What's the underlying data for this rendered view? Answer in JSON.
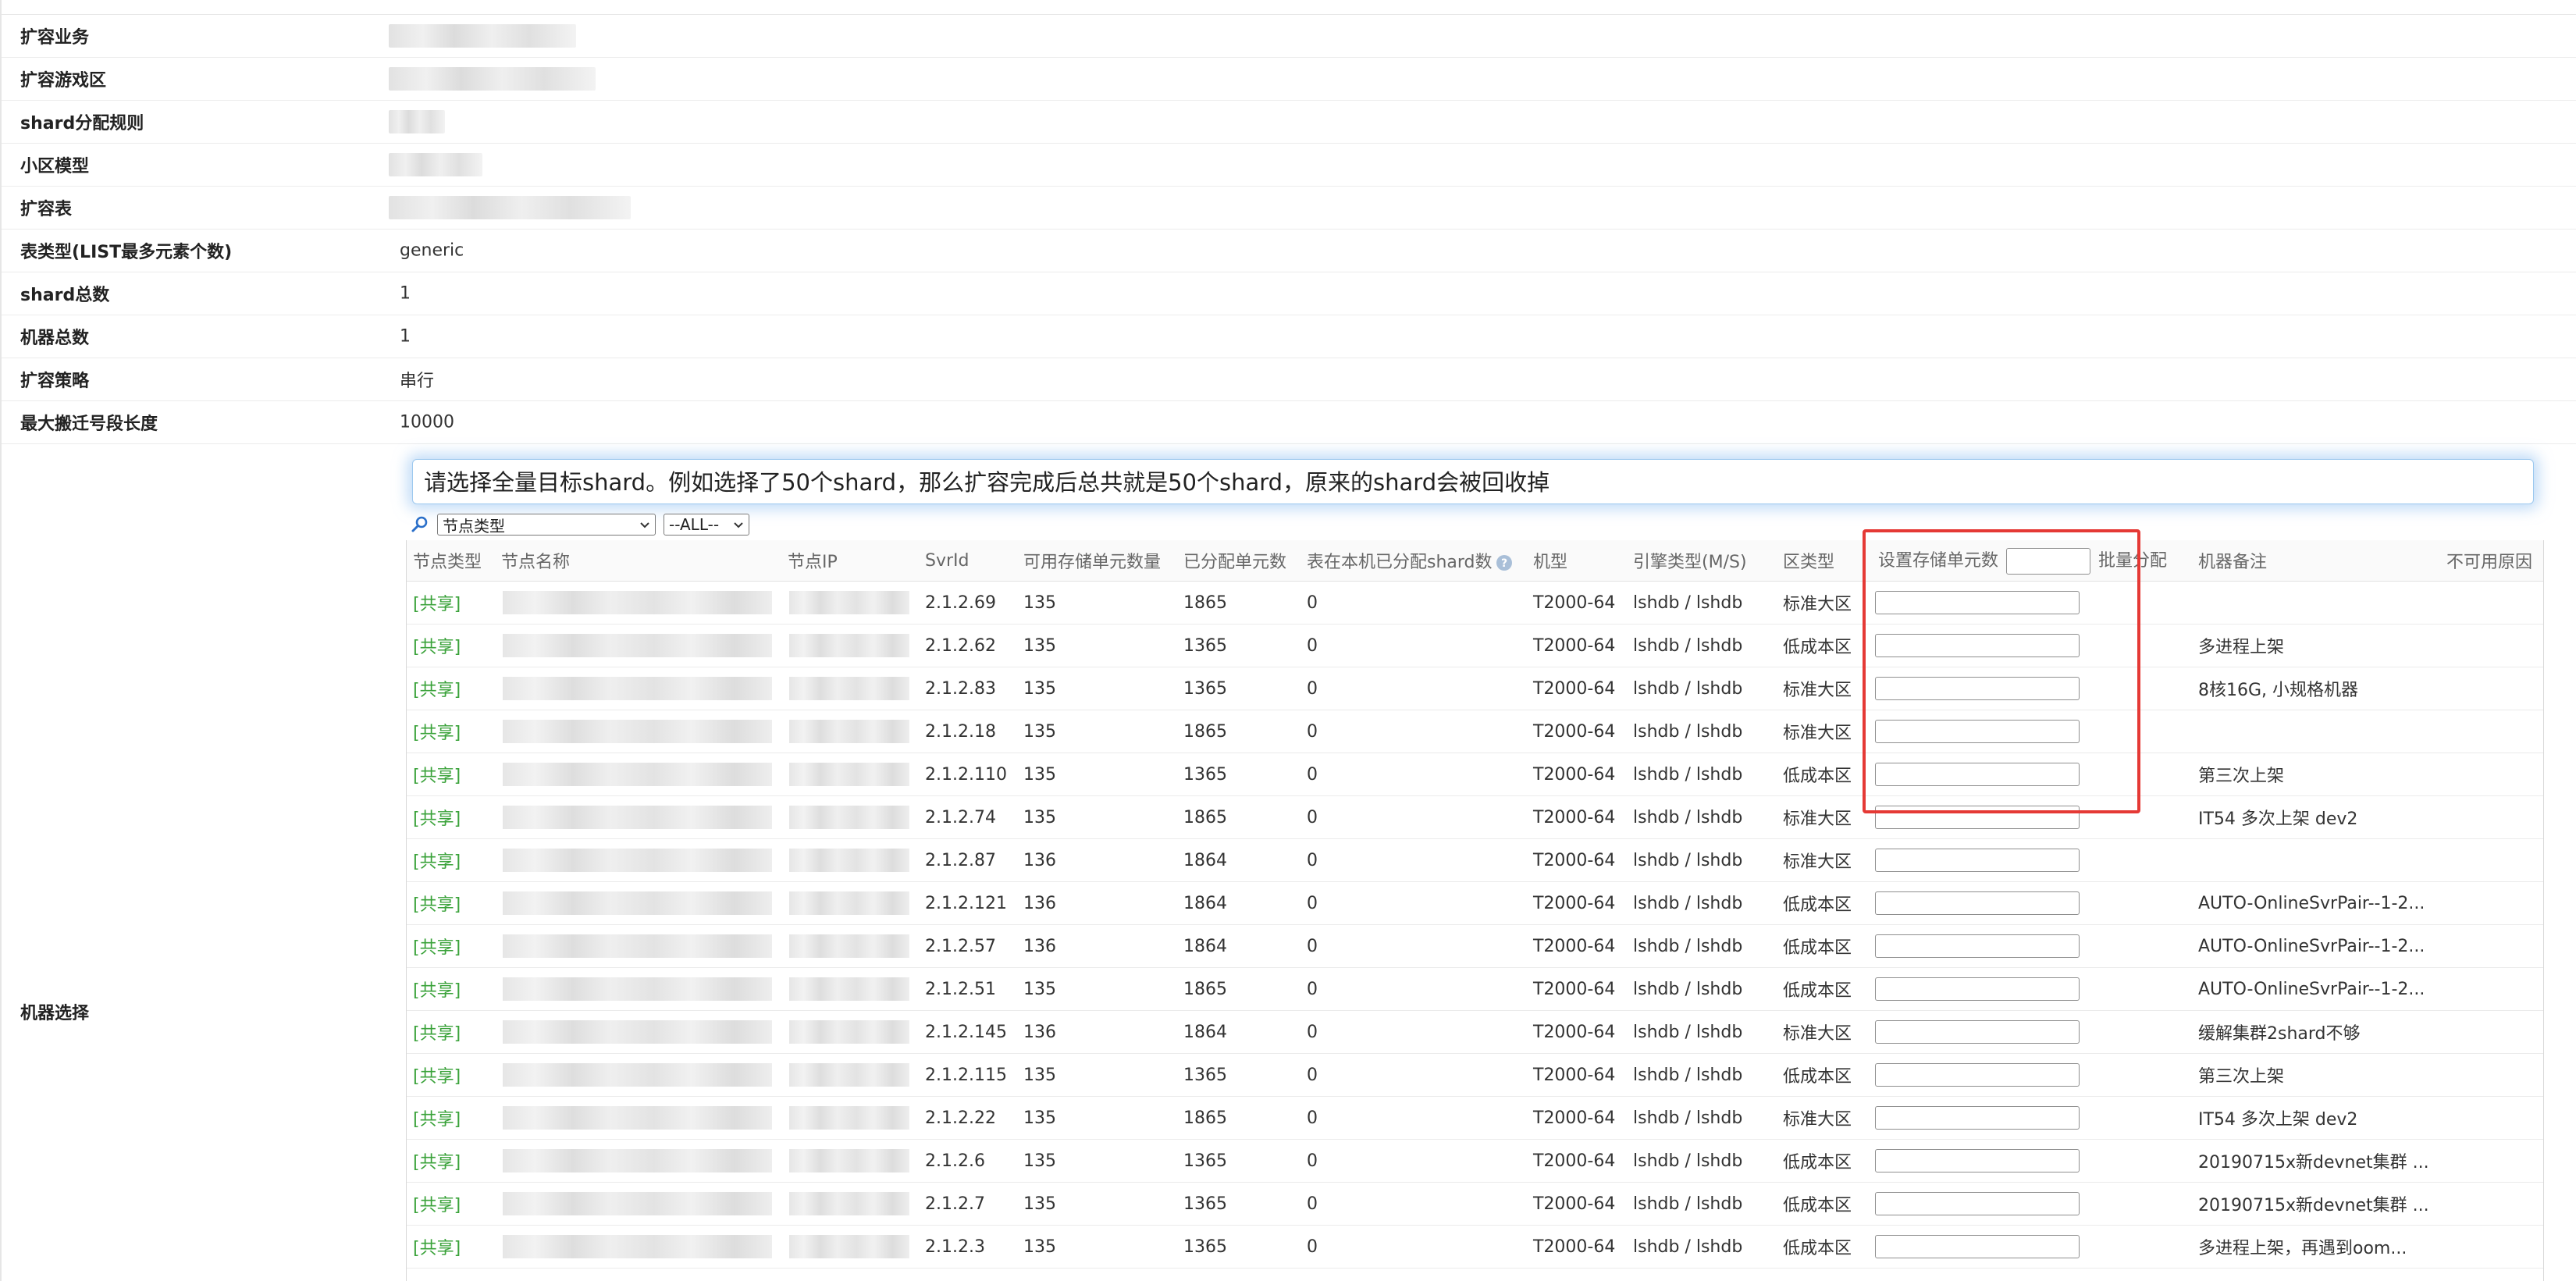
{
  "info": [
    {
      "label": "扩容业务",
      "value": "",
      "redacted": true
    },
    {
      "label": "扩容游戏区",
      "value": "",
      "redacted": true
    },
    {
      "label": "shard分配规则",
      "value": "",
      "redacted": true
    },
    {
      "label": "小区模型",
      "value": "",
      "redacted": true
    },
    {
      "label": "扩容表",
      "value": "",
      "redacted": true
    },
    {
      "label": "表类型(LIST最多元素个数)",
      "value": "generic",
      "redacted": false
    },
    {
      "label": "shard总数",
      "value": "1",
      "redacted": false
    },
    {
      "label": "机器总数",
      "value": "1",
      "redacted": false
    },
    {
      "label": "扩容策略",
      "value": "串行",
      "redacted": false
    },
    {
      "label": "最大搬迁号段长度",
      "value": "10000",
      "redacted": false
    }
  ],
  "machine_section": {
    "label": "机器选择",
    "hint": "请选择全量目标shard。例如选择了50个shard，那么扩容完成后总共就是50个shard，原来的shard会被回收掉",
    "filter_type_value": "节点类型",
    "filter_all_value": "--ALL--",
    "search_icon": "search-icon"
  },
  "table": {
    "headers": {
      "node_type": "节点类型",
      "node_name": "节点名称",
      "node_ip": "节点IP",
      "svrid": "SvrId",
      "avail": "可用存储单元数量",
      "alloc": "已分配单元数",
      "local_shard": "表在本机已分配shard数",
      "model": "机型",
      "engine": "引擎类型(M/S)",
      "zone": "区类型",
      "set_units": "设置存储单元数",
      "batch": "批量分配",
      "remark": "机器备注",
      "unavail": "不可用原因"
    },
    "rows": [
      {
        "type": "[共享]",
        "svrid": "2.1.2.69",
        "avail": "135",
        "alloc": "1865",
        "local": "0",
        "model": "T2000-64",
        "engine": "lshdb / lshdb",
        "zone": "标准大区",
        "remark": ""
      },
      {
        "type": "[共享]",
        "svrid": "2.1.2.62",
        "avail": "135",
        "alloc": "1365",
        "local": "0",
        "model": "T2000-64",
        "engine": "lshdb / lshdb",
        "zone": "低成本区",
        "remark": "多进程上架"
      },
      {
        "type": "[共享]",
        "svrid": "2.1.2.83",
        "avail": "135",
        "alloc": "1365",
        "local": "0",
        "model": "T2000-64",
        "engine": "lshdb / lshdb",
        "zone": "标准大区",
        "remark": "8核16G, 小规格机器"
      },
      {
        "type": "[共享]",
        "svrid": "2.1.2.18",
        "avail": "135",
        "alloc": "1865",
        "local": "0",
        "model": "T2000-64",
        "engine": "lshdb / lshdb",
        "zone": "标准大区",
        "remark": ""
      },
      {
        "type": "[共享]",
        "svrid": "2.1.2.110",
        "avail": "135",
        "alloc": "1365",
        "local": "0",
        "model": "T2000-64",
        "engine": "lshdb / lshdb",
        "zone": "低成本区",
        "remark": "第三次上架"
      },
      {
        "type": "[共享]",
        "svrid": "2.1.2.74",
        "avail": "135",
        "alloc": "1865",
        "local": "0",
        "model": "T2000-64",
        "engine": "lshdb / lshdb",
        "zone": "标准大区",
        "remark": "IT54 多次上架 dev2"
      },
      {
        "type": "[共享]",
        "svrid": "2.1.2.87",
        "avail": "136",
        "alloc": "1864",
        "local": "0",
        "model": "T2000-64",
        "engine": "lshdb / lshdb",
        "zone": "标准大区",
        "remark": ""
      },
      {
        "type": "[共享]",
        "svrid": "2.1.2.121",
        "avail": "136",
        "alloc": "1864",
        "local": "0",
        "model": "T2000-64",
        "engine": "lshdb / lshdb",
        "zone": "低成本区",
        "remark": "AUTO-OnlineSvrPair--1-2..."
      },
      {
        "type": "[共享]",
        "svrid": "2.1.2.57",
        "avail": "136",
        "alloc": "1864",
        "local": "0",
        "model": "T2000-64",
        "engine": "lshdb / lshdb",
        "zone": "低成本区",
        "remark": "AUTO-OnlineSvrPair--1-2..."
      },
      {
        "type": "[共享]",
        "svrid": "2.1.2.51",
        "avail": "135",
        "alloc": "1865",
        "local": "0",
        "model": "T2000-64",
        "engine": "lshdb / lshdb",
        "zone": "低成本区",
        "remark": "AUTO-OnlineSvrPair--1-2..."
      },
      {
        "type": "[共享]",
        "svrid": "2.1.2.145",
        "avail": "136",
        "alloc": "1864",
        "local": "0",
        "model": "T2000-64",
        "engine": "lshdb / lshdb",
        "zone": "标准大区",
        "remark": "缓解集群2shard不够"
      },
      {
        "type": "[共享]",
        "svrid": "2.1.2.115",
        "avail": "135",
        "alloc": "1365",
        "local": "0",
        "model": "T2000-64",
        "engine": "lshdb / lshdb",
        "zone": "低成本区",
        "remark": "第三次上架"
      },
      {
        "type": "[共享]",
        "svrid": "2.1.2.22",
        "avail": "135",
        "alloc": "1865",
        "local": "0",
        "model": "T2000-64",
        "engine": "lshdb / lshdb",
        "zone": "标准大区",
        "remark": "IT54 多次上架 dev2"
      },
      {
        "type": "[共享]",
        "svrid": "2.1.2.6",
        "avail": "135",
        "alloc": "1365",
        "local": "0",
        "model": "T2000-64",
        "engine": "lshdb / lshdb",
        "zone": "低成本区",
        "remark": "20190715x新devnet集群 ..."
      },
      {
        "type": "[共享]",
        "svrid": "2.1.2.7",
        "avail": "135",
        "alloc": "1365",
        "local": "0",
        "model": "T2000-64",
        "engine": "lshdb / lshdb",
        "zone": "低成本区",
        "remark": "20190715x新devnet集群 ..."
      },
      {
        "type": "[共享]",
        "svrid": "2.1.2.3",
        "avail": "135",
        "alloc": "1365",
        "local": "0",
        "model": "T2000-64",
        "engine": "lshdb / lshdb",
        "zone": "低成本区",
        "remark": "多进程上架，再遇到oom..."
      }
    ]
  }
}
